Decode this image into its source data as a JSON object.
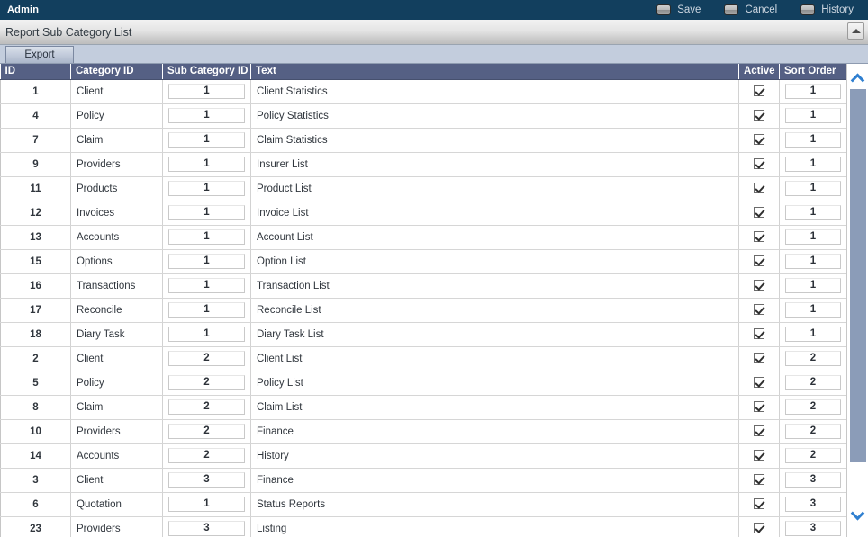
{
  "titlebar": {
    "app_title": "Admin",
    "actions": [
      {
        "label": "Save",
        "icon": "save-icon"
      },
      {
        "label": "Cancel",
        "icon": "cancel-icon"
      },
      {
        "label": "History",
        "icon": "history-icon"
      }
    ]
  },
  "page": {
    "title": "Report Sub Category List",
    "collapse_icon": "chevron-up-icon"
  },
  "toolbar": {
    "export_label": "Export"
  },
  "grid": {
    "columns": [
      "ID",
      "Category ID",
      "Sub Category ID",
      "Text",
      "Active",
      "Sort Order"
    ],
    "rows": [
      {
        "id": "1",
        "category": "Client",
        "sub": "1",
        "text": "Client Statistics",
        "active": true,
        "sort": "1"
      },
      {
        "id": "4",
        "category": "Policy",
        "sub": "1",
        "text": "Policy Statistics",
        "active": true,
        "sort": "1"
      },
      {
        "id": "7",
        "category": "Claim",
        "sub": "1",
        "text": "Claim Statistics",
        "active": true,
        "sort": "1"
      },
      {
        "id": "9",
        "category": "Providers",
        "sub": "1",
        "text": "Insurer List",
        "active": true,
        "sort": "1"
      },
      {
        "id": "11",
        "category": "Products",
        "sub": "1",
        "text": "Product List",
        "active": true,
        "sort": "1"
      },
      {
        "id": "12",
        "category": "Invoices",
        "sub": "1",
        "text": "Invoice List",
        "active": true,
        "sort": "1"
      },
      {
        "id": "13",
        "category": "Accounts",
        "sub": "1",
        "text": "Account List",
        "active": true,
        "sort": "1"
      },
      {
        "id": "15",
        "category": "Options",
        "sub": "1",
        "text": "Option List",
        "active": true,
        "sort": "1"
      },
      {
        "id": "16",
        "category": "Transactions",
        "sub": "1",
        "text": "Transaction List",
        "active": true,
        "sort": "1"
      },
      {
        "id": "17",
        "category": "Reconcile",
        "sub": "1",
        "text": "Reconcile List",
        "active": true,
        "sort": "1"
      },
      {
        "id": "18",
        "category": "Diary Task",
        "sub": "1",
        "text": "Diary Task List",
        "active": true,
        "sort": "1"
      },
      {
        "id": "2",
        "category": "Client",
        "sub": "2",
        "text": "Client List",
        "active": true,
        "sort": "2"
      },
      {
        "id": "5",
        "category": "Policy",
        "sub": "2",
        "text": "Policy List",
        "active": true,
        "sort": "2"
      },
      {
        "id": "8",
        "category": "Claim",
        "sub": "2",
        "text": "Claim List",
        "active": true,
        "sort": "2"
      },
      {
        "id": "10",
        "category": "Providers",
        "sub": "2",
        "text": "Finance",
        "active": true,
        "sort": "2"
      },
      {
        "id": "14",
        "category": "Accounts",
        "sub": "2",
        "text": "History",
        "active": true,
        "sort": "2"
      },
      {
        "id": "3",
        "category": "Client",
        "sub": "3",
        "text": "Finance",
        "active": true,
        "sort": "3"
      },
      {
        "id": "6",
        "category": "Quotation",
        "sub": "1",
        "text": "Status Reports",
        "active": true,
        "sort": "3"
      },
      {
        "id": "23",
        "category": "Providers",
        "sub": "3",
        "text": "Listing",
        "active": true,
        "sort": "3"
      }
    ]
  },
  "scrollbar": {
    "up_icon": "chevron-up-icon",
    "down_icon": "chevron-down-icon"
  },
  "colors": {
    "titlebar": "#123f5e",
    "grid_header": "#556084",
    "toolstrip": "#c3cddd",
    "scroll_thumb": "#8b9cb8",
    "scroll_arrow": "#2f7fd0"
  }
}
